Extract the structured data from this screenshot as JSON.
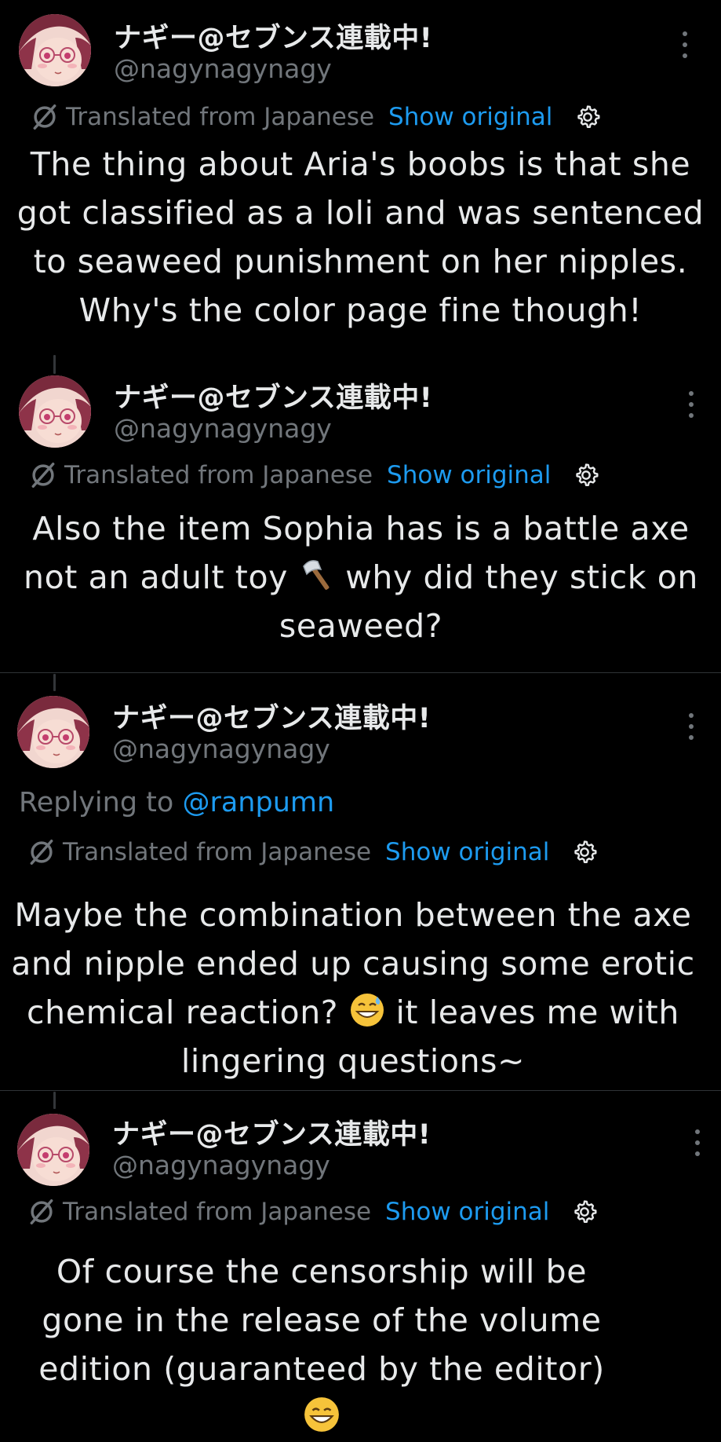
{
  "tweets": [
    {
      "display_name": "ナギー@セブンス連載中!",
      "handle": "@nagynagynagy",
      "translated_label": "Translated from Japanese",
      "show_original": "Show original",
      "body": "The thing about Aria's boobs is that she got classified as a loli and was sentenced to seaweed punishment on her nipples. Why's the color page fine though!"
    },
    {
      "display_name": "ナギー@セブンス連載中!",
      "handle": "@nagynagynagy",
      "translated_label": "Translated from Japanese",
      "show_original": "Show original",
      "body_part1": "Also the item Sophia has is a battle axe not an adult toy",
      "body_emoji": "axe-emoji",
      "body_part2": "why did they stick on seaweed?"
    },
    {
      "display_name": "ナギー@セブンス連載中!",
      "handle": "@nagynagynagy",
      "replying_prefix": "Replying to",
      "replying_to": "@ranpumn",
      "translated_label": "Translated from Japanese",
      "show_original": "Show original",
      "body_part1": "Maybe the combination between the axe and nipple ended up causing some erotic chemical reaction?",
      "body_emoji": "grinning-sweat-emoji",
      "body_part2": "it leaves me with lingering questions~"
    },
    {
      "display_name": "ナギー@セブンス連載中!",
      "handle": "@nagynagynagy",
      "translated_label": "Translated from Japanese",
      "show_original": "Show original",
      "body": "Of course the censorship will be gone in the release of the volume edition (guaranteed by the editor)",
      "body_emoji": "grinning-emoji"
    }
  ],
  "colors": {
    "background": "#000000",
    "text": "#e7e9ea",
    "secondary": "#71767b",
    "link": "#1d9bf0",
    "divider": "#2f3336"
  },
  "icons": [
    "avatar",
    "more-icon",
    "translate-icon",
    "settings-gear-icon"
  ]
}
